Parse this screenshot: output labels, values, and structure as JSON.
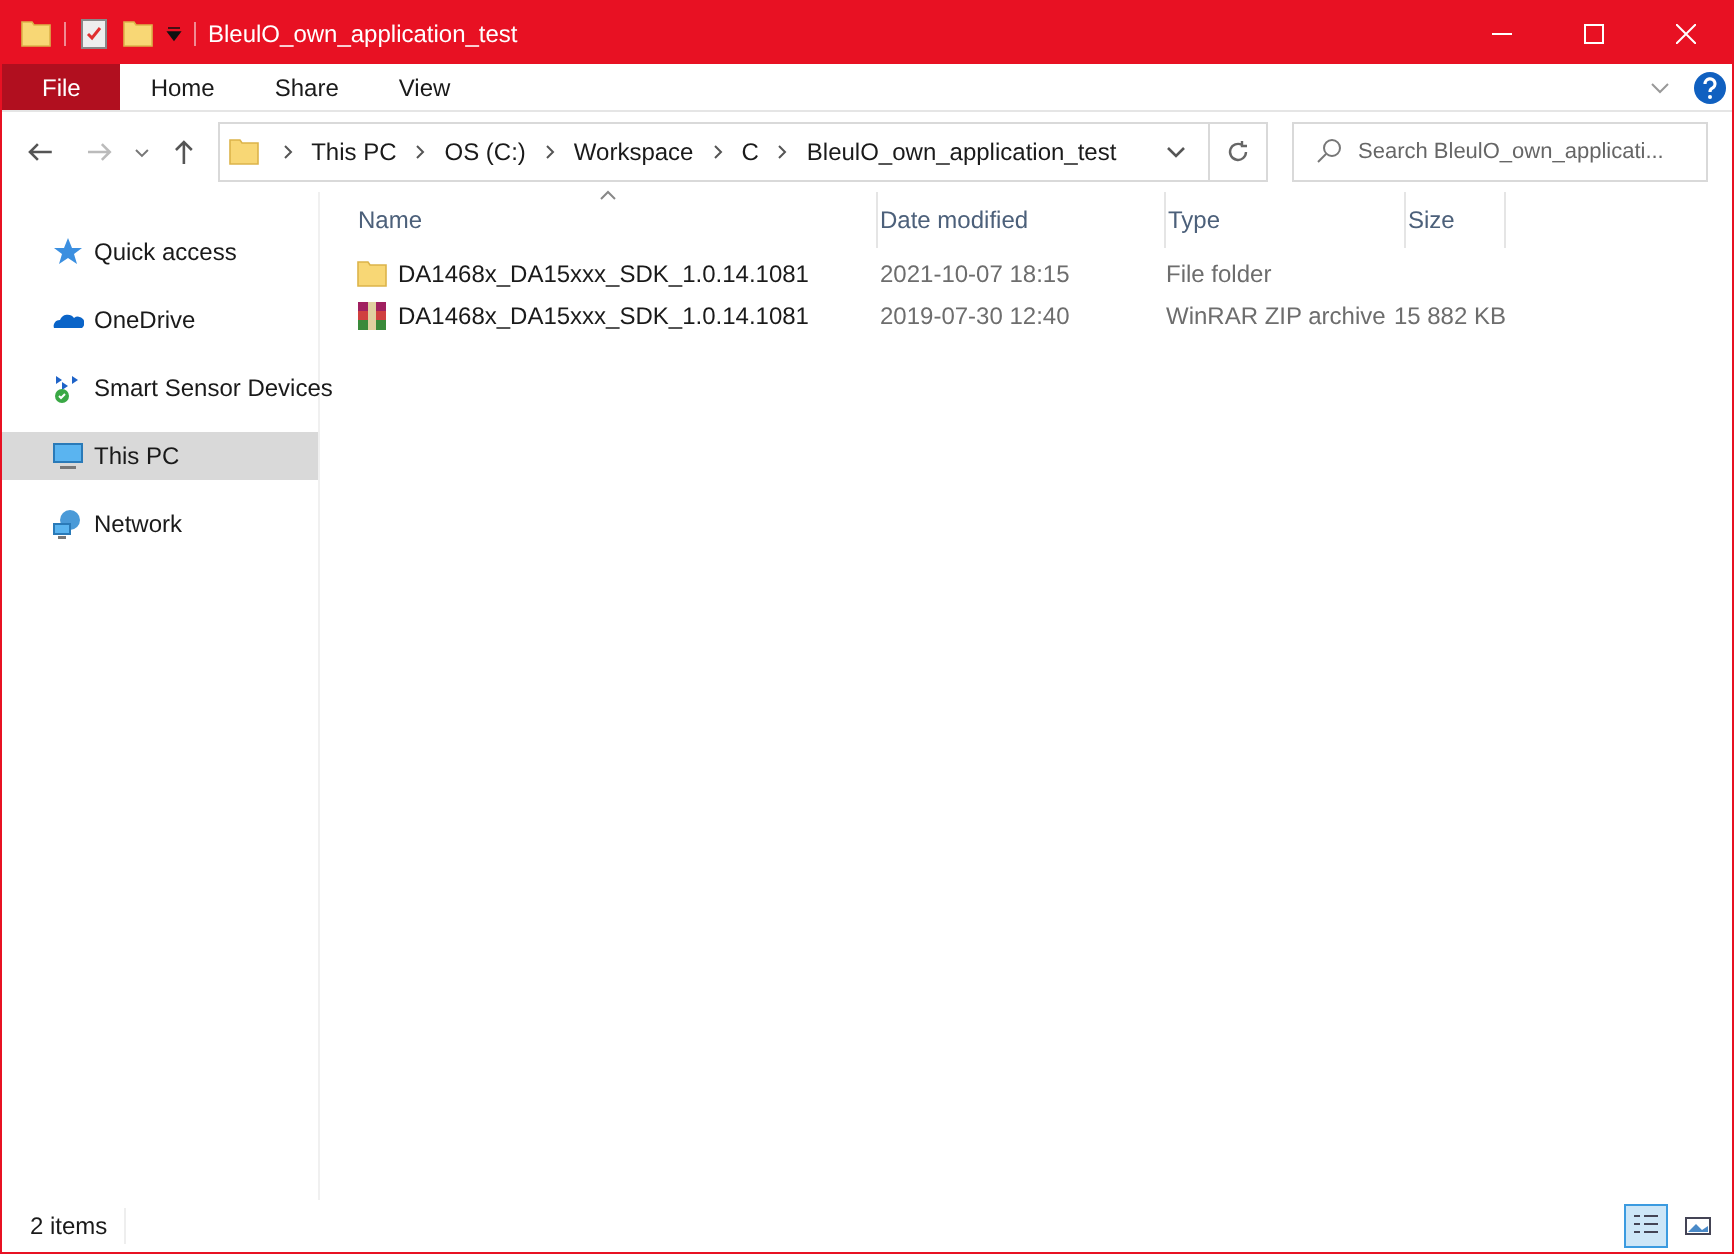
{
  "window": {
    "title": "BleulO_own_application_test"
  },
  "ribbon_tabs": [
    {
      "label": "File",
      "kind": "file"
    },
    {
      "label": "Home",
      "kind": "tab"
    },
    {
      "label": "Share",
      "kind": "tab"
    },
    {
      "label": "View",
      "kind": "tab"
    }
  ],
  "breadcrumbs": [
    "This PC",
    "OS (C:)",
    "Workspace",
    "C",
    "BleulO_own_application_test"
  ],
  "search": {
    "placeholder": "Search BleulO_own_applicati..."
  },
  "sidebar": {
    "items": [
      {
        "label": "Quick access",
        "kind": "star",
        "selected": false
      },
      {
        "label": "OneDrive",
        "kind": "cloud",
        "selected": false
      },
      {
        "label": "Smart Sensor Devices",
        "kind": "sync",
        "selected": false
      },
      {
        "label": "This PC",
        "kind": "pc",
        "selected": true
      },
      {
        "label": "Network",
        "kind": "network",
        "selected": false
      }
    ]
  },
  "table": {
    "columns": [
      "Name",
      "Date modified",
      "Type",
      "Size"
    ],
    "rows": [
      {
        "kind": "folder",
        "name": "DA1468x_DA15xxx_SDK_1.0.14.1081",
        "date": "2021-10-07 18:15",
        "type": "File folder",
        "size": ""
      },
      {
        "kind": "archive",
        "name": "DA1468x_DA15xxx_SDK_1.0.14.1081",
        "date": "2019-07-30 12:40",
        "type": "WinRAR ZIP archive",
        "size": "15 882 KB"
      }
    ]
  },
  "status_bar": {
    "count": "2 items",
    "views": [
      {
        "kind": "details",
        "selected": true
      },
      {
        "kind": "tiles",
        "selected": false
      }
    ]
  }
}
